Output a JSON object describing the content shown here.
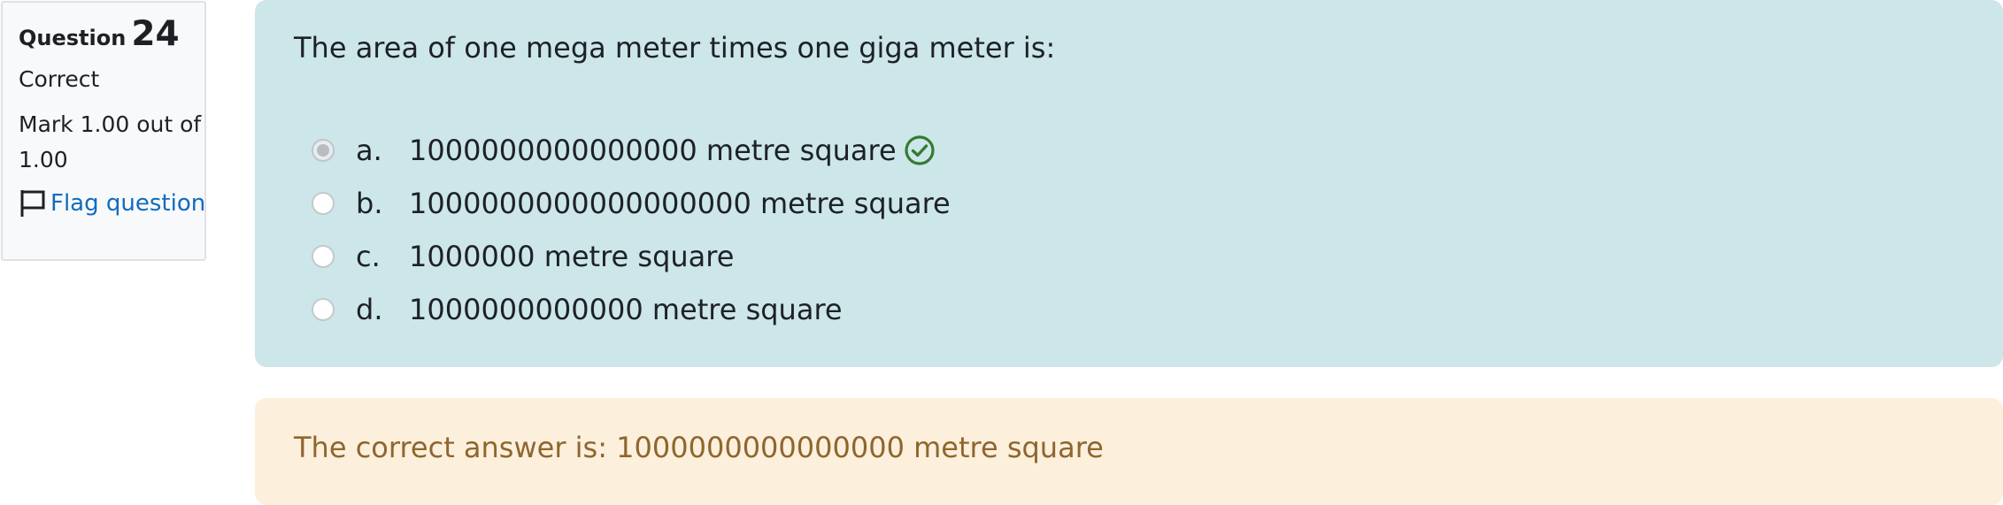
{
  "info": {
    "question_word": "Question",
    "question_number": "24",
    "state": "Correct",
    "grade": "Mark 1.00 out of 1.00",
    "flag_label": "Flag question"
  },
  "question": {
    "text": "The area of one mega meter times one giga meter is:",
    "answers": [
      {
        "letter": "a.",
        "text": "1000000000000000 metre square",
        "selected": true,
        "correct": true
      },
      {
        "letter": "b.",
        "text": "1000000000000000000 metre square",
        "selected": false,
        "correct": false
      },
      {
        "letter": "c.",
        "text": "1000000 metre square",
        "selected": false,
        "correct": false
      },
      {
        "letter": "d.",
        "text": "1000000000000 metre square",
        "selected": false,
        "correct": false
      }
    ]
  },
  "feedback": {
    "right_answer": "The correct answer is: 1000000000000000 metre square"
  },
  "icons": {
    "flag": "flag-icon",
    "correct": "check-circle-icon",
    "radio": "radio-button"
  },
  "colors": {
    "question_bg": "#cce6ea",
    "feedback_bg": "#fcefdc",
    "feedback_text": "#8e662e",
    "link": "#0f6cbf",
    "correct_green": "#357a32"
  }
}
